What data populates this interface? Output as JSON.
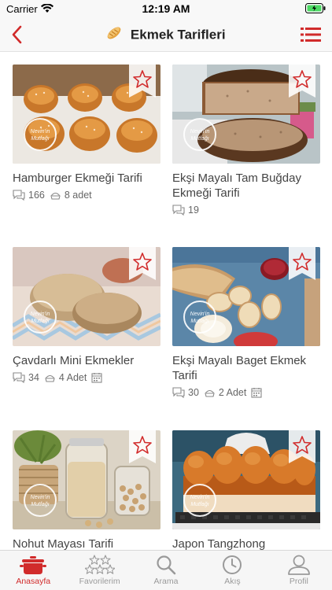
{
  "status": {
    "carrier": "Carrier",
    "time": "12:19 AM"
  },
  "nav": {
    "title": "Ekmek Tarifleri",
    "back_icon": "chevron-left-icon",
    "menu_icon": "list-menu-icon",
    "accent": "#d12b2b"
  },
  "stamp": {
    "line1": "Nevin'in",
    "line2": "Mutfağı"
  },
  "recipes": [
    {
      "title": "Hamburger Ekmeği Tarifi",
      "comments": "166",
      "portion": "8 adet"
    },
    {
      "title": "Ekşi Mayalı Tam Buğday Ekmeği Tarifi",
      "comments": "19"
    },
    {
      "title": "Çavdarlı Mini Ekmekler",
      "comments": "34",
      "portion": "4 Adet"
    },
    {
      "title": "Ekşi Mayalı Baget Ekmek Tarifi",
      "comments": "30",
      "portion": "2 Adet"
    },
    {
      "title": "Nohut Mayası Tarifi"
    },
    {
      "title": "Japon Tangzhong"
    }
  ],
  "tabs": [
    {
      "label": "Anasayfa",
      "icon": "pot-icon",
      "active": true
    },
    {
      "label": "Favorilerim",
      "icon": "stars-icon"
    },
    {
      "label": "Arama",
      "icon": "search-icon"
    },
    {
      "label": "Akış",
      "icon": "clock-icon"
    },
    {
      "label": "Profil",
      "icon": "user-icon"
    }
  ]
}
